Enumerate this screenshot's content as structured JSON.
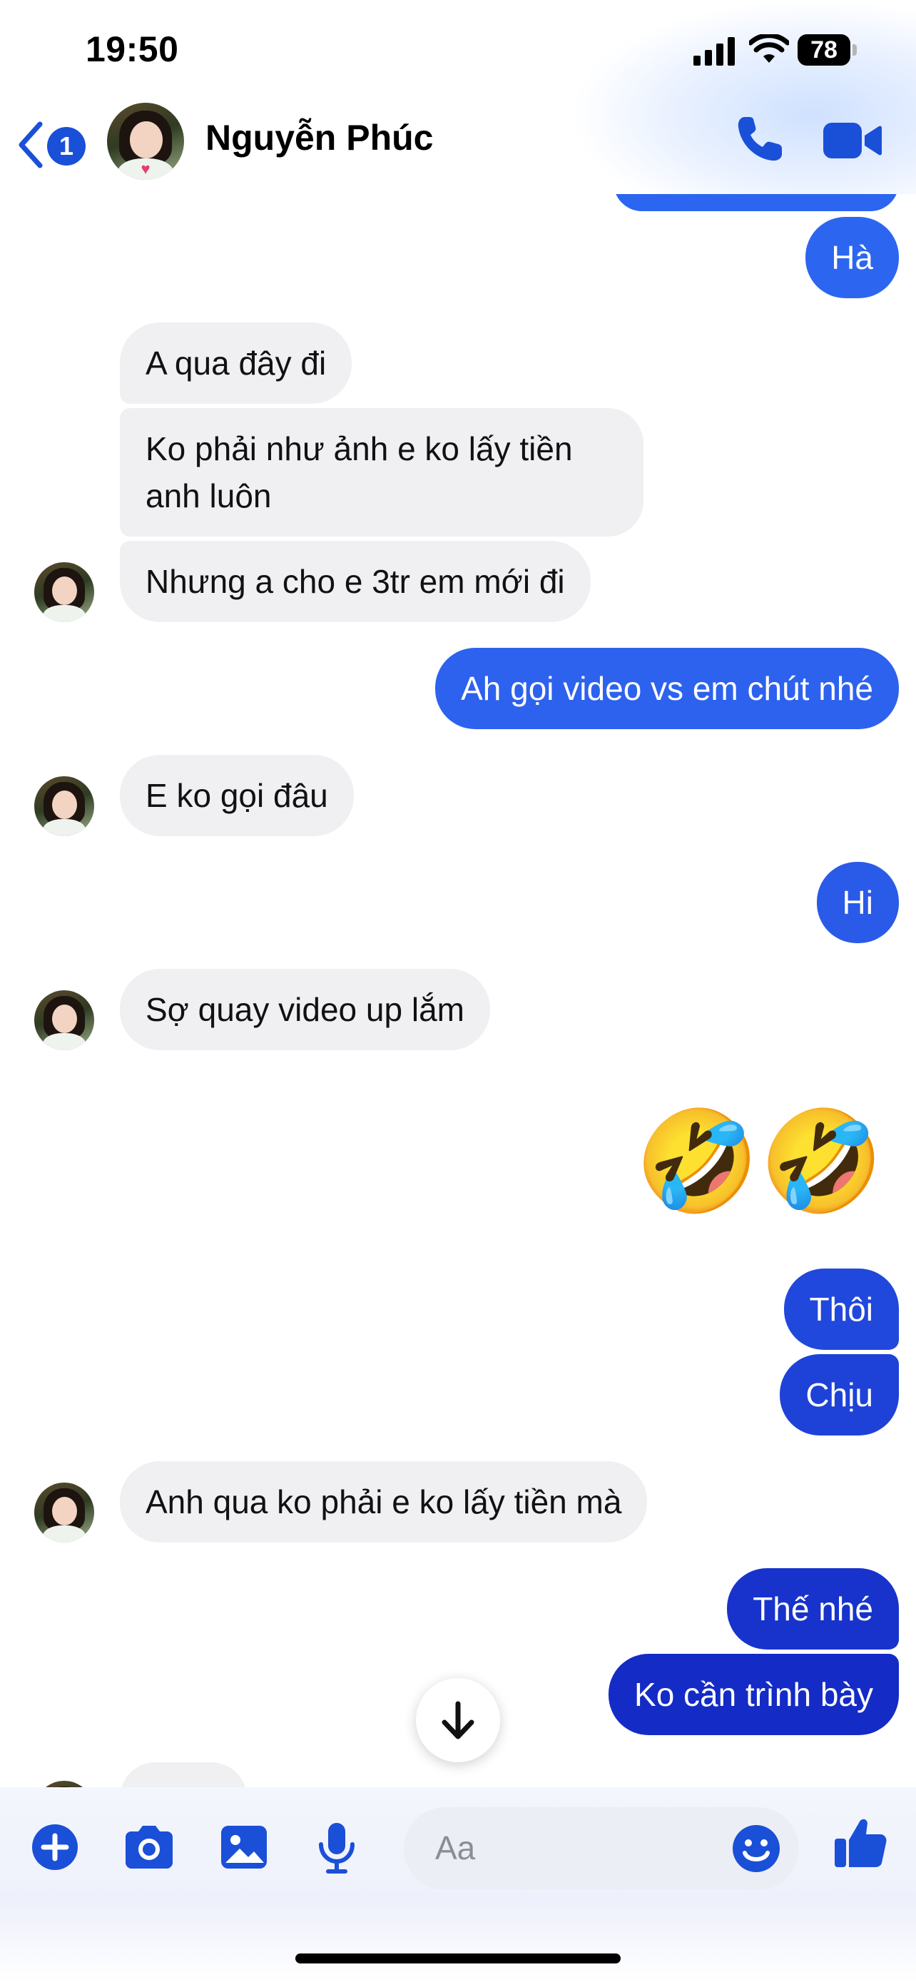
{
  "status": {
    "time": "19:50",
    "battery": "78"
  },
  "header": {
    "contact_name": "Nguyễn Phúc",
    "unread_count": "1"
  },
  "messages": {
    "out_ha": "Hà",
    "in_1": "A qua đây đi",
    "in_2_line1": "Ko phải như ảnh e ko lấy tiền",
    "in_2_line2": "anh luôn",
    "in_3": "Nhưng a cho e 3tr em mới đi",
    "out_video": "Ah gọi video vs em chút nhé",
    "in_4": "E ko gọi đâu",
    "out_hi": "Hi",
    "in_5": "Sợ quay video up lắm",
    "out_emoji": "🤣🤣",
    "out_thoi": "Thôi",
    "out_chiu": "Chịu",
    "in_6": "Anh qua ko phải e ko lấy tiền mà",
    "out_the_nhe": "Thế nhé",
    "out_ko_can": "Ko cần trình bày"
  },
  "composer": {
    "placeholder": "Aa"
  },
  "colors": {
    "accent": "#1a4fd8",
    "bubble_out_light": "#2f6cf0",
    "bubble_out_dark": "#1428c8",
    "bubble_in": "#f0f0f3"
  },
  "icons": [
    "back-chevron-icon",
    "phone-icon",
    "video-camera-icon",
    "plus-icon",
    "camera-icon",
    "gallery-icon",
    "microphone-icon",
    "smiley-icon",
    "thumbs-up-icon",
    "arrow-down-icon"
  ]
}
